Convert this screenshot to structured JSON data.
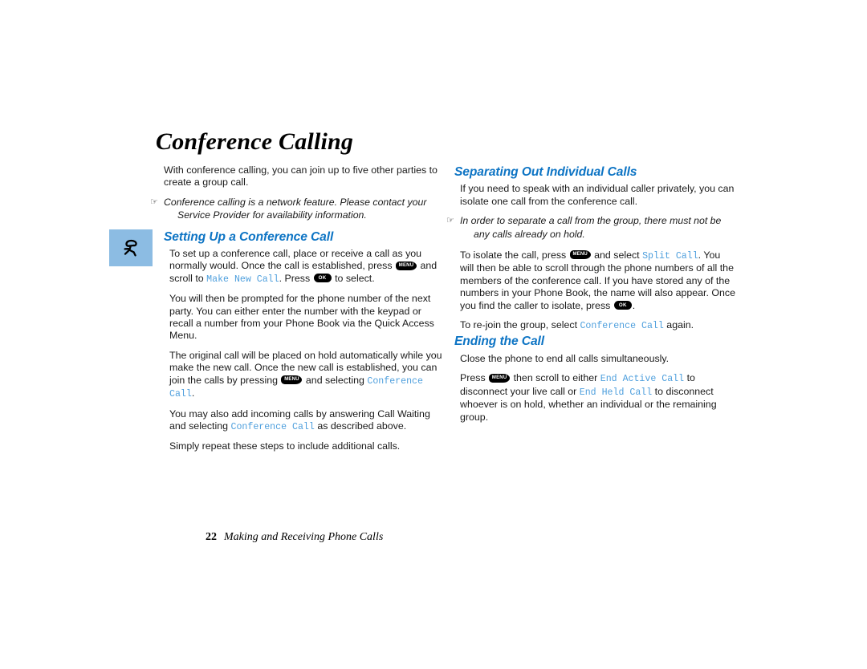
{
  "page": {
    "title": "Conference Calling",
    "footer": {
      "page_number": "22",
      "section_title": "Making and Receiving Phone Calls"
    },
    "margin_icon": {
      "name": "running-phone-icon",
      "background_color": "#8CBCE3"
    }
  },
  "colors": {
    "heading_blue": "#0D74C4",
    "mono_blue": "#4E9FDD",
    "icon_box_blue": "#8CBCE3",
    "body_text": "#1A1A1A"
  },
  "keys": {
    "menu_label": "MENU",
    "ok_label": "OK",
    "hand_glyph": "☞"
  },
  "left_column": {
    "intro_paragraph": "With conference calling, you can join up to five other parties to create a group call.",
    "intro_note": "Conference calling is a network feature. Please contact your Service Provider for availability information.",
    "section_heading": "Setting Up a Conference Call",
    "p1_a": "To set up a conference call, place or receive a call as you normally would. Once the call is established, press",
    "p1_b": "and scroll to",
    "p1_menu_1": "Make New Call",
    "p1_c": ". Press",
    "p1_d": "to select.",
    "p2": "You will then be prompted for the phone number of the next party. You can either enter the number with the keypad or recall a number from your Phone Book via the Quick Access Menu.",
    "p3_a": "The original call will be placed on hold automatically while you make the new call. Once the new call is established, you can join the calls by pressing",
    "p3_b": "and selecting",
    "p3_menu_1": "Conference Call",
    "p3_c": ".",
    "p4_a": "You may also add incoming calls by answering Call Waiting and selecting",
    "p4_menu_1": "Conference Call",
    "p4_b": "as described above.",
    "p5": "Simply repeat these steps to include additional calls."
  },
  "right_column": {
    "section_heading_1": "Separating Out Individual Calls",
    "r_p1": "If you need to speak with an individual caller privately, you can isolate one call from the conference call.",
    "r_note": "In order to separate a call from the group, there must not be any calls already on hold.",
    "r_p2_a": "To isolate the call, press",
    "r_p2_b": "and select",
    "r_p2_menu_1": "Split Call",
    "r_p2_c": ". You will then be able to scroll through the phone numbers of all the members of the conference call. If you have stored any of the numbers in your Phone Book, the name will also appear. Once you find the caller to isolate, press",
    "r_p2_d": ".",
    "r_p3_a": "To re-join the group, select",
    "r_p3_menu_1": "Conference Call",
    "r_p3_b": "again.",
    "section_heading_2": "Ending the Call",
    "r_p4": "Close the phone to end all calls simultaneously.",
    "r_p5_a": "Press",
    "r_p5_b": "then scroll to either",
    "r_p5_menu_1": "End Active Call",
    "r_p5_c": "to disconnect your live call or",
    "r_p5_menu_2": "End Held Call",
    "r_p5_d": "to disconnect whoever is on hold, whether an individual or the remaining group."
  }
}
